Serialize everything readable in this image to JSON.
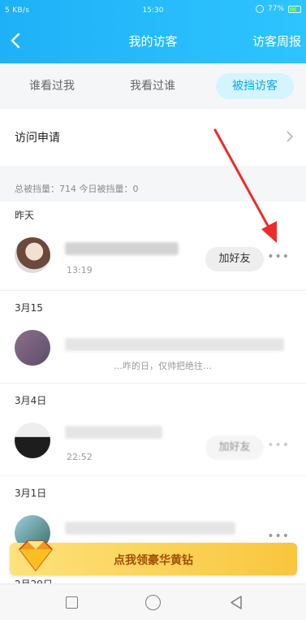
{
  "status_bar": {
    "left": "5 KB/s",
    "time": "15:30",
    "battery": "77%"
  },
  "header": {
    "title": "我的访客",
    "weekly_label": "访客周报"
  },
  "tabs": [
    {
      "label": "谁看过我",
      "active": false
    },
    {
      "label": "我看过谁",
      "active": false
    },
    {
      "label": "被挡访客",
      "active": true
    }
  ],
  "visit_request": {
    "label": "访问申请"
  },
  "summary": {
    "text": "总被挡量：714   今日被挡量：0"
  },
  "sections": [
    {
      "date": "昨天"
    },
    {
      "date": "3月15"
    },
    {
      "date": "3月4日"
    },
    {
      "date": "3月1日"
    }
  ],
  "rows": [
    {
      "time": "13:19",
      "button": "加好友"
    },
    {
      "sub": "…咋的日，仅帅把绝往…"
    },
    {
      "time": "22:52",
      "button": "加好友"
    },
    {}
  ],
  "promo": {
    "text": "点我领豪华黄钻"
  },
  "bottom_date": "2月29日",
  "colors": {
    "header": "#1fb1f7",
    "accent": "#11a6e8",
    "promo": "#f9c63c"
  }
}
